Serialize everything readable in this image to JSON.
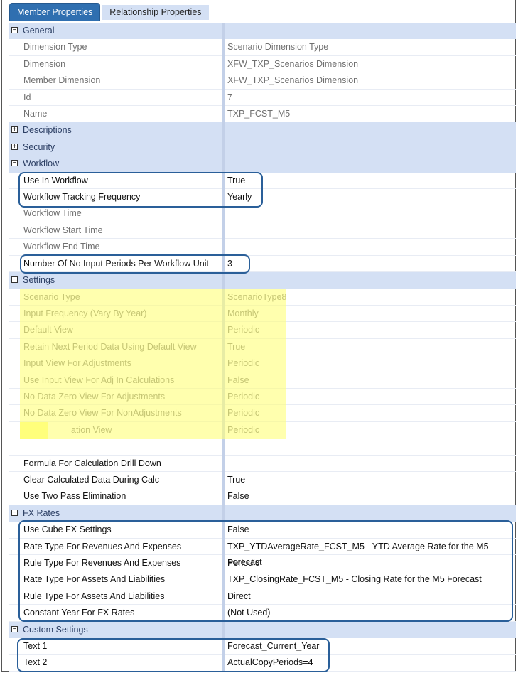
{
  "tabs": [
    {
      "label": "Member Properties",
      "active": true
    },
    {
      "label": "Relationship Properties",
      "active": false
    }
  ],
  "rows": [
    {
      "type": "section",
      "label": "General",
      "expanded": true
    },
    {
      "name": "Dimension Type",
      "value": "Scenario Dimension Type",
      "readonly": true
    },
    {
      "name": "Dimension",
      "value": "XFW_TXP_Scenarios Dimension",
      "readonly": true
    },
    {
      "name": "Member Dimension",
      "value": "XFW_TXP_Scenarios Dimension",
      "readonly": true
    },
    {
      "name": "Id",
      "value": "7",
      "readonly": true
    },
    {
      "name": "Name",
      "value": "TXP_FCST_M5",
      "readonly": true
    },
    {
      "type": "section",
      "label": "Descriptions",
      "expanded": false
    },
    {
      "type": "section",
      "label": "Security",
      "expanded": false
    },
    {
      "type": "section",
      "label": "Workflow",
      "expanded": true
    },
    {
      "name": "Use In Workflow",
      "value": "True"
    },
    {
      "name": "Workflow Tracking Frequency",
      "value": "Yearly"
    },
    {
      "name": "Workflow Time",
      "value": "",
      "readonly": true
    },
    {
      "name": "Workflow Start Time",
      "value": "",
      "readonly": true
    },
    {
      "name": "Workflow End Time",
      "value": "",
      "readonly": true
    },
    {
      "name": "Number Of No Input Periods Per Workflow Unit",
      "value": "3"
    },
    {
      "type": "section",
      "label": "Settings",
      "expanded": true
    },
    {
      "name": "Scenario Type",
      "value": "ScenarioType8",
      "readonly": true
    },
    {
      "name": "Input Frequency (Vary By Year)",
      "value": "Monthly",
      "readonly": true
    },
    {
      "name": "Default View",
      "value": "Periodic",
      "readonly": true
    },
    {
      "name": "Retain Next Period Data Using Default View",
      "value": "True",
      "readonly": true
    },
    {
      "name": "Input View For Adjustments",
      "value": "Periodic",
      "readonly": true
    },
    {
      "name": "Use Input View For Adj In Calculations",
      "value": "False",
      "readonly": true
    },
    {
      "name": "No Data Zero View For Adjustments",
      "value": "Periodic",
      "readonly": true
    },
    {
      "name": "No Data Zero View For NonAdjustments",
      "value": "Periodic",
      "readonly": true
    },
    {
      "name": "ation View",
      "value": "Periodic",
      "readonly": true,
      "obscured": true
    },
    {
      "name": "",
      "value": ""
    },
    {
      "name": "Formula For Calculation Drill Down",
      "value": ""
    },
    {
      "name": "Clear Calculated Data During Calc",
      "value": "True"
    },
    {
      "name": "Use Two Pass Elimination",
      "value": "False"
    },
    {
      "type": "section",
      "label": "FX Rates",
      "expanded": true
    },
    {
      "name": "Use Cube FX Settings",
      "value": "False"
    },
    {
      "name": "Rate Type For Revenues And Expenses",
      "value": "TXP_YTDAverageRate_FCST_M5 - YTD Average Rate for the M5 Forecast"
    },
    {
      "name": "Rule Type For Revenues And Expenses",
      "value": "Periodic"
    },
    {
      "name": "Rate Type For Assets And Liabilities",
      "value": "TXP_ClosingRate_FCST_M5 - Closing Rate for the M5 Forecast"
    },
    {
      "name": "Rule Type For Assets And Liabilities",
      "value": "Direct"
    },
    {
      "name": "Constant Year For FX Rates",
      "value": "(Not Used)"
    },
    {
      "type": "section",
      "label": "Custom Settings",
      "expanded": true
    },
    {
      "name": "Text 1",
      "value": "Forecast_Current_Year"
    },
    {
      "name": "Text 2",
      "value": "ActualCopyPeriods=4"
    }
  ],
  "colors": {
    "accent": "#2f6fb0",
    "section": "#d4e0f4",
    "highlight": "#ffff78",
    "callout": "#2a5f99"
  }
}
